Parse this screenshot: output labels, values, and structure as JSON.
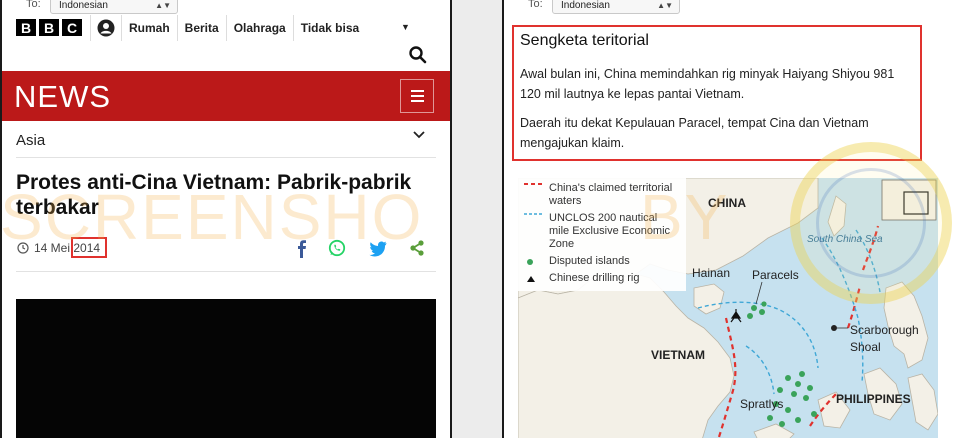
{
  "left_panel": {
    "translate_to_label": "To:",
    "translate_language": "Indonesian",
    "logo_letters": [
      "B",
      "B",
      "C"
    ],
    "nav_items": [
      "Rumah",
      "Berita",
      "Olahraga",
      "Tidak bisa"
    ],
    "news_title": "NEWS",
    "section": "Asia",
    "headline": "Protes anti-Cina Vietnam: Pabrik-pabrik terbakar",
    "date_day_month": "14 Mei",
    "date_year": "2014"
  },
  "right_panel": {
    "translate_to_label": "To:",
    "translate_language": "Indonesian",
    "box_title": "Sengketa teritorial",
    "paragraph_1": "Awal bulan ini, China memindahkan rig minyak Haiyang Shiyou 981 120 mil lautnya ke lepas pantai Vietnam.",
    "paragraph_2": "Daerah itu dekat Kepulauan Paracel, tempat Cina dan Vietnam mengajukan klaim.",
    "map": {
      "legend": [
        {
          "key": "red-dash",
          "label": "China's claimed territorial waters"
        },
        {
          "key": "blue-dash",
          "label": "UNCLOS 200 nautical mile Exclusive Economic Zone"
        },
        {
          "key": "green-dot",
          "label": "Disputed islands"
        },
        {
          "key": "rig-icon",
          "label": "Chinese drilling rig"
        }
      ],
      "labels": {
        "china": "CHINA",
        "hainan": "Hainan",
        "paracels": "Paracels",
        "south_china_sea": "South China Sea",
        "scarborough": "Scarborough\nShoal",
        "vietnam": "VIETNAM",
        "spratlys": "Spratlys",
        "philippines": "PHILIPPINES"
      }
    }
  },
  "watermark": {
    "left": "SCREENSHO",
    "right": "BY"
  },
  "colors": {
    "bbc_red": "#bb1919",
    "highlight_red": "#e0322e",
    "facebook": "#3b5998",
    "whatsapp": "#25d366",
    "twitter": "#1da1f2",
    "share_green": "#5a9e3a",
    "claimed_waters": "#e0322e",
    "eez": "#3fa7d6",
    "islands": "#3aa35a",
    "sea": "#c6e1ef",
    "land": "#f3f0e7"
  }
}
